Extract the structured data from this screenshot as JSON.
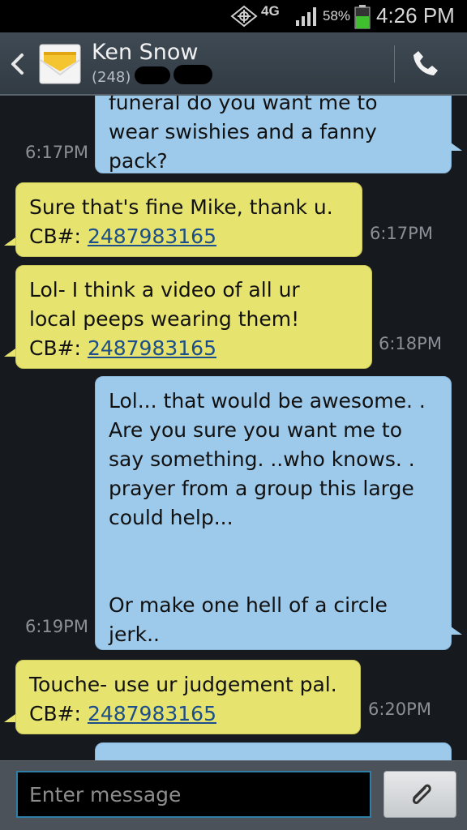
{
  "status_bar": {
    "network": "4G",
    "battery_percent": "58%",
    "battery_level": 0.58,
    "time": "4:26 PM"
  },
  "header": {
    "contact_name": "Ken Snow",
    "contact_number": "(248)",
    "icons": {
      "back": "back-chevron-icon",
      "avatar": "envelope-icon",
      "call": "phone-icon"
    }
  },
  "messages": [
    {
      "dir": "out",
      "text": "funeral do you want me to\nwear swishies and a fanny\npack?",
      "time": "6:17PM"
    },
    {
      "dir": "in",
      "text": "Sure that's fine Mike, thank u.",
      "cb_label": "CB#: ",
      "cb_number": "2487983165",
      "time": "6:17PM"
    },
    {
      "dir": "in",
      "text": "Lol- I think a video of all ur\nlocal peeps wearing them!",
      "cb_label": "CB#: ",
      "cb_number": "2487983165",
      "time": "6:18PM"
    },
    {
      "dir": "out",
      "text": "Lol... that would be awesome. .\nAre you sure you want me to\nsay something. ..who knows. .\nprayer from a group this large\ncould help...\n\n\nOr make one hell of a circle\njerk..",
      "time": "6:19PM"
    },
    {
      "dir": "in",
      "text": "Touche- use ur judgement pal.",
      "cb_label": "CB#: ",
      "cb_number": "2487983165",
      "time": "6:20PM"
    },
    {
      "dir": "out",
      "text": "",
      "time": ""
    }
  ],
  "composer": {
    "placeholder": "Enter message",
    "attach_icon": "paperclip-icon"
  },
  "colors": {
    "incoming_bubble": "#e6e36e",
    "outgoing_bubble": "#9dc9ea",
    "background": "#16191e",
    "input_border": "#2d7fa6"
  }
}
